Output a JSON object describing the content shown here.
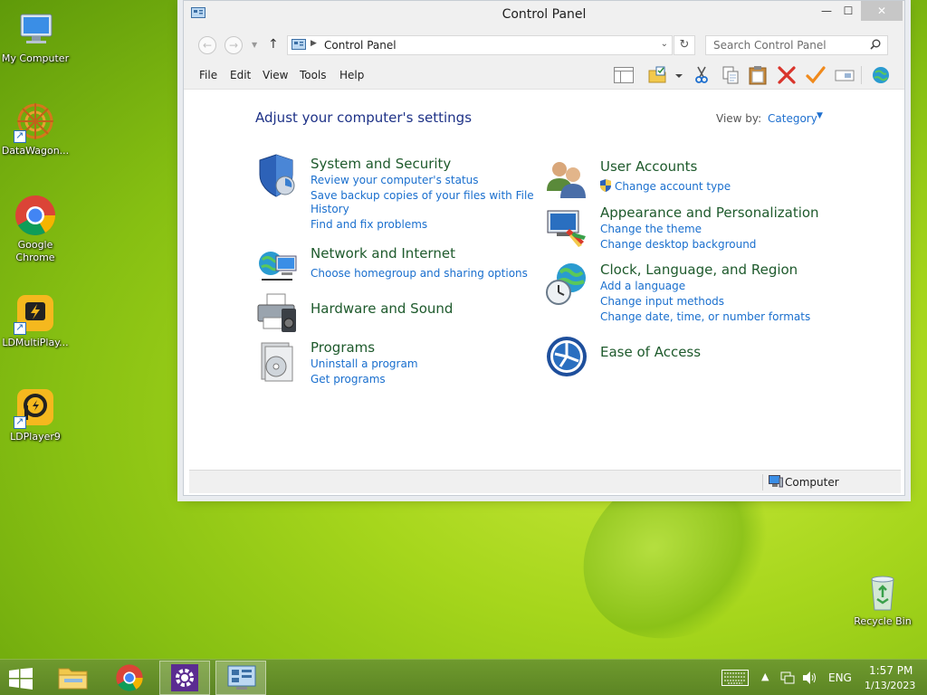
{
  "desktop": {
    "icons": [
      {
        "label": "My Computer"
      },
      {
        "label": "DataWagon..."
      },
      {
        "label": "Google Chrome"
      },
      {
        "label": "LDMultiPlay..."
      },
      {
        "label": "LDPlayer9"
      },
      {
        "label": "Recycle Bin"
      }
    ]
  },
  "window": {
    "title": "Control Panel",
    "controls": {
      "minimize": "—",
      "maximize": "☐",
      "close": "✕"
    },
    "address": {
      "crumb": "Control Panel"
    },
    "search": {
      "placeholder": "Search Control Panel"
    },
    "menu": [
      "File",
      "Edit",
      "View",
      "Tools",
      "Help"
    ],
    "heading": "Adjust your computer's settings",
    "view_by": {
      "label": "View by:",
      "value": "Category"
    },
    "categories": [
      {
        "title": "System and Security",
        "links": [
          "Review your computer's status",
          "Save backup copies of your files with File",
          "History",
          "Find and fix problems"
        ]
      },
      {
        "title": "Network and Internet",
        "links": [
          "Choose homegroup and sharing options"
        ]
      },
      {
        "title": "Hardware and Sound",
        "links": []
      },
      {
        "title": "Programs",
        "links": [
          "Uninstall a program",
          "Get programs"
        ]
      },
      {
        "title": "User Accounts",
        "links": [
          "Change account type"
        ]
      },
      {
        "title": "Appearance and Personalization",
        "links": [
          "Change the theme",
          "Change desktop background"
        ]
      },
      {
        "title": "Clock, Language, and Region",
        "links": [
          "Add a language",
          "Change input methods",
          "Change date, time, or number formats"
        ]
      },
      {
        "title": "Ease of Access",
        "links": []
      }
    ],
    "status": "Computer"
  },
  "taskbar": {
    "language": "ENG",
    "time": "1:57 PM",
    "date": "1/13/2023"
  },
  "colors": {
    "link": "#1a6fce",
    "category_title": "#1e5a2c",
    "heading": "#1e3287",
    "taskbar": "#5c8524"
  }
}
